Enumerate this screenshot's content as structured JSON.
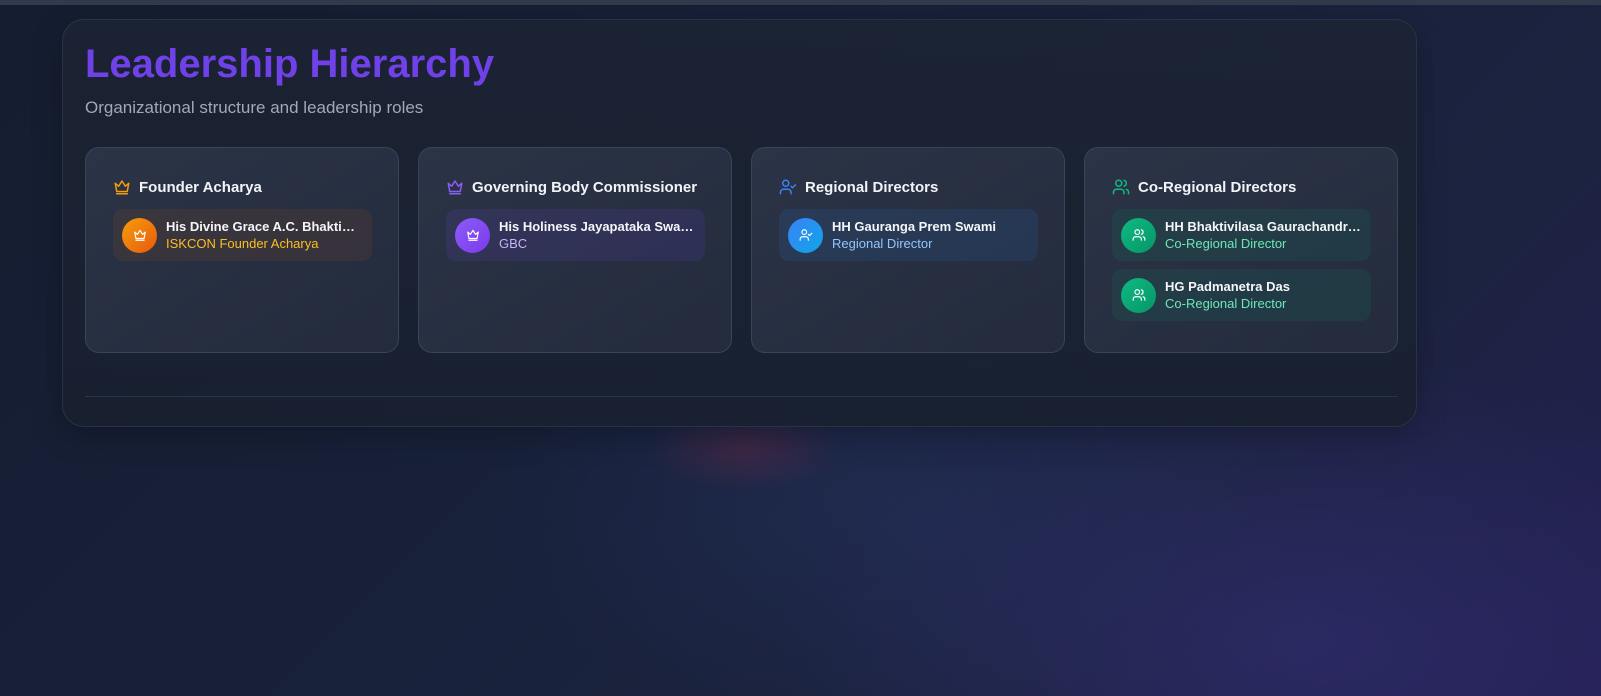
{
  "page": {
    "title": "Leadership Hierarchy",
    "subtitle": "Organizational structure and leadership roles"
  },
  "colors": {
    "title": "#7041e8",
    "founder_accent": "#f59e0b",
    "gbc_accent": "#8b5cf6",
    "regional_accent": "#3b82f6",
    "co_regional_accent": "#10b981"
  },
  "groups": [
    {
      "title": "Founder Acharya",
      "icon": "crown-icon",
      "members": [
        {
          "name": "His Divine Grace A.C. Bhaktivedanta Swami Prabhupada",
          "role": "ISKCON Founder Acharya",
          "icon": "crown-icon"
        }
      ]
    },
    {
      "title": "Governing Body Commissioner",
      "icon": "crown-icon",
      "members": [
        {
          "name": "His Holiness Jayapataka Swami",
          "role": "GBC",
          "icon": "crown-icon"
        }
      ]
    },
    {
      "title": "Regional Directors",
      "icon": "user-check-icon",
      "members": [
        {
          "name": "HH Gauranga Prem Swami",
          "role": "Regional Director",
          "icon": "user-check-icon"
        }
      ]
    },
    {
      "title": "Co-Regional Directors",
      "icon": "users-icon",
      "members": [
        {
          "name": "HH Bhaktivilasa Gaurachandra Swami",
          "role": "Co-Regional Director",
          "icon": "users-icon"
        },
        {
          "name": "HG Padmanetra Das",
          "role": "Co-Regional Director",
          "icon": "users-icon"
        }
      ]
    }
  ]
}
